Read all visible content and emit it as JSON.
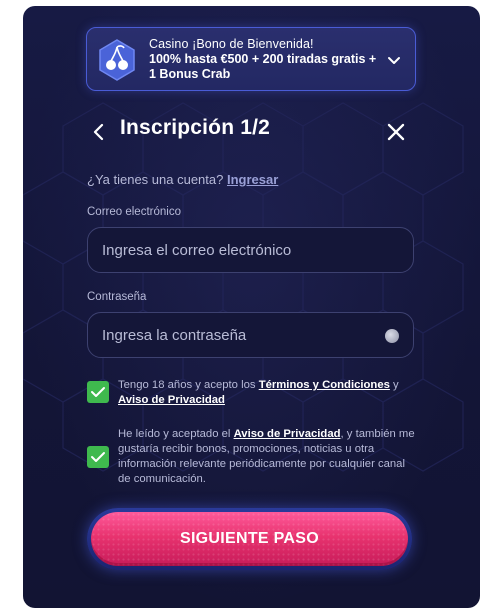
{
  "banner": {
    "title": "Casino ¡Bono de Bienvenida!",
    "description": "100% hasta €500 + 200 tiradas gratis + 1 Bonus Crab",
    "icon": "cherries-icon",
    "accent": "#4a5cd6"
  },
  "header": {
    "title": "Inscripción 1/2",
    "back_icon": "chevron-left-icon",
    "close_icon": "close-icon"
  },
  "login": {
    "prompt": "¿Ya tienes una cuenta?",
    "link": "Ingresar"
  },
  "form": {
    "email": {
      "label": "Correo electrónico",
      "placeholder": "Ingresa el correo electrónico",
      "value": ""
    },
    "password": {
      "label": "Contraseña",
      "placeholder": "Ingresa la contraseña",
      "value": ""
    }
  },
  "consent": {
    "terms": {
      "checked": true,
      "text_before": "Tengo 18 años y acepto los ",
      "terms_link": "Términos y Condiciones",
      "text_mid": " y",
      "privacy_link": "Aviso de Privacidad"
    },
    "marketing": {
      "checked": true,
      "text_before": "He leído y aceptado el ",
      "privacy_link": "Aviso de Privacidad",
      "text_after": ", y también me gustaría recibir bonos, promociones, noticias u otra información relevante periódicamente por cualquier canal de comunicación."
    }
  },
  "cta": {
    "label": "SIGUIENTE PASO"
  },
  "colors": {
    "background": "#131537",
    "check": "#3fb94e",
    "cta": "#e8336f"
  }
}
